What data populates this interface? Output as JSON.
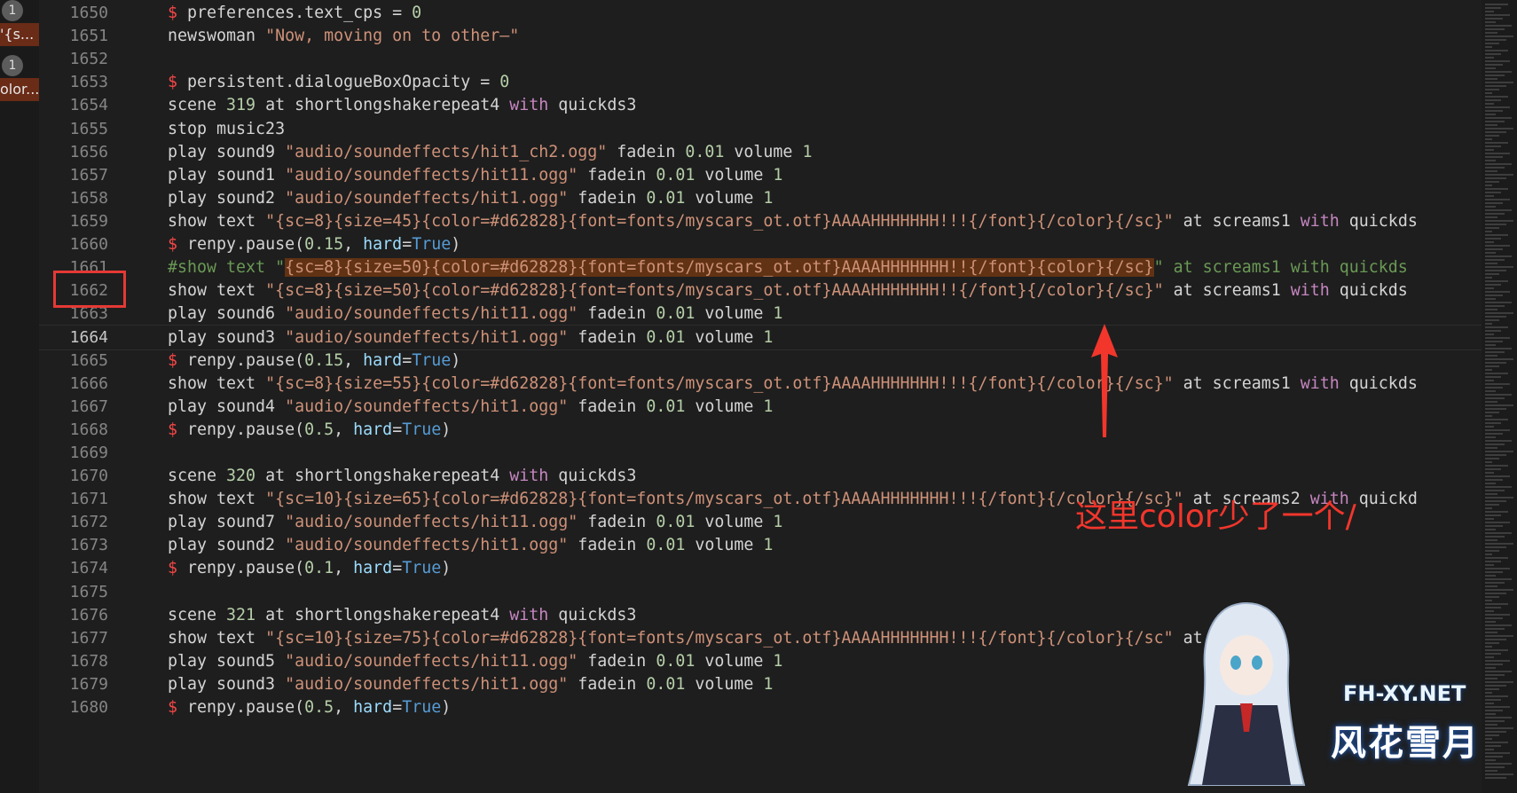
{
  "left_panel": {
    "badge1": "1",
    "chip1": "'{s...",
    "badge2": "1",
    "chip2": "olor..."
  },
  "code_lines": [
    {
      "n": "1650",
      "t": "$ preferences.text_cps = 0"
    },
    {
      "n": "1651",
      "t": "newswoman \"Now, moving on to other—\""
    },
    {
      "n": "1652",
      "t": ""
    },
    {
      "n": "1653",
      "t": "$ persistent.dialogueBoxOpacity = 0"
    },
    {
      "n": "1654",
      "t": "scene 319 at shortlongshakerepeat4 with quickds3"
    },
    {
      "n": "1655",
      "t": "stop music23"
    },
    {
      "n": "1656",
      "t": "play sound9 \"audio/soundeffects/hit1_ch2.ogg\" fadein 0.01 volume 1"
    },
    {
      "n": "1657",
      "t": "play sound1 \"audio/soundeffects/hit11.ogg\" fadein 0.01 volume 1"
    },
    {
      "n": "1658",
      "t": "play sound2 \"audio/soundeffects/hit1.ogg\" fadein 0.01 volume 1"
    },
    {
      "n": "1659",
      "t": "show text \"{sc=8}{size=45}{color=#d62828}{font=fonts/myscars_ot.otf}AAAAHHHHHHH!!!{/font}{/color}{/sc}\" at screams1 with quickds"
    },
    {
      "n": "1660",
      "t": "$ renpy.pause(0.15, hard=True)"
    },
    {
      "n": "1661",
      "t": "#show text \"{sc=8}{size=50}{color=#d62828}{font=fonts/myscars_ot.otf}AAAAHHHHHHH!!{/font}{color}{/sc}\" at screams1 with quickds"
    },
    {
      "n": "1662",
      "t": "show text \"{sc=8}{size=50}{color=#d62828}{font=fonts/myscars_ot.otf}AAAAHHHHHHH!!{/font}{/color}{/sc}\" at screams1 with quickds"
    },
    {
      "n": "1663",
      "t": "play sound6 \"audio/soundeffects/hit11.ogg\" fadein 0.01 volume 1"
    },
    {
      "n": "1664",
      "t": "play sound3 \"audio/soundeffects/hit1.ogg\" fadein 0.01 volume 1"
    },
    {
      "n": "1665",
      "t": "$ renpy.pause(0.15, hard=True)"
    },
    {
      "n": "1666",
      "t": "show text \"{sc=8}{size=55}{color=#d62828}{font=fonts/myscars_ot.otf}AAAAHHHHHHH!!!{/font}{/color}{/sc}\" at screams1 with quickds"
    },
    {
      "n": "1667",
      "t": "play sound4 \"audio/soundeffects/hit1.ogg\" fadein 0.01 volume 1"
    },
    {
      "n": "1668",
      "t": "$ renpy.pause(0.5, hard=True)"
    },
    {
      "n": "1669",
      "t": ""
    },
    {
      "n": "1670",
      "t": "scene 320 at shortlongshakerepeat4 with quickds3"
    },
    {
      "n": "1671",
      "t": "show text \"{sc=10}{size=65}{color=#d62828}{font=fonts/myscars_ot.otf}AAAAHHHHHHH!!!{/font}{/color}{/sc}\" at screams2 with quickd"
    },
    {
      "n": "1672",
      "t": "play sound7 \"audio/soundeffects/hit11.ogg\" fadein 0.01 volume 1"
    },
    {
      "n": "1673",
      "t": "play sound2 \"audio/soundeffects/hit1.ogg\" fadein 0.01 volume 1"
    },
    {
      "n": "1674",
      "t": "$ renpy.pause(0.1, hard=True)"
    },
    {
      "n": "1675",
      "t": ""
    },
    {
      "n": "1676",
      "t": "scene 321 at shortlongshakerepeat4 with quickds3"
    },
    {
      "n": "1677",
      "t": "show text \"{sc=10}{size=75}{color=#d62828}{font=fonts/myscars_ot.otf}AAAAHHHHHHH!!!{/font}{/color}{/sc\" at screams"
    },
    {
      "n": "1678",
      "t": "play sound5 \"audio/soundeffects/hit11.ogg\" fadein 0.01 volume 1"
    },
    {
      "n": "1679",
      "t": "play sound3 \"audio/soundeffects/hit1.ogg\" fadein 0.01 volume 1"
    },
    {
      "n": "1680",
      "t": "$ renpy.pause(0.5, hard=True)"
    }
  ],
  "active_line": "1664",
  "boxed_line": "1661",
  "annotation": "这里color少了一个/",
  "watermark": {
    "domain": "FH-XY.NET",
    "chinese": "风花雪月"
  },
  "colors": {
    "background": "#1e1e1e",
    "annotation_red": "#f2362c",
    "highlight": "#613214"
  }
}
